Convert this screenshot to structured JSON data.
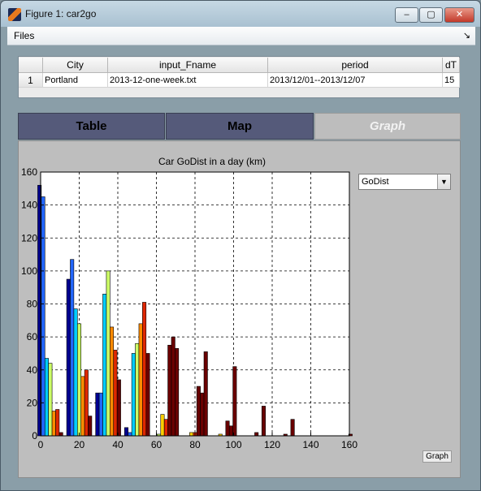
{
  "window": {
    "title": "Figure 1: car2go"
  },
  "menu": {
    "files": "Files",
    "dock_arrow": "↘"
  },
  "window_controls": {
    "minimize": "–",
    "maximize": "▢",
    "close": "✕"
  },
  "table": {
    "columns": [
      "",
      "City",
      "input_Fname",
      "period",
      "dT"
    ],
    "rows": [
      {
        "index": "1",
        "city": "Portland",
        "input_fname": "2013-12-one-week.txt",
        "period": "2013/12/01--2013/12/07",
        "dt": "15"
      }
    ]
  },
  "tabs": [
    {
      "label": "Table",
      "active": false
    },
    {
      "label": "Map",
      "active": false
    },
    {
      "label": "Graph",
      "active": true
    }
  ],
  "graph": {
    "selector_value": "GoDist",
    "button_label": "Graph"
  },
  "chart_data": {
    "type": "bar",
    "title": "Car GoDist in a day (km)",
    "xlim": [
      0,
      160
    ],
    "ylim": [
      0,
      160
    ],
    "xticks": [
      0,
      20,
      40,
      60,
      80,
      100,
      120,
      140,
      160
    ],
    "yticks": [
      0,
      20,
      40,
      60,
      80,
      100,
      120,
      140,
      160
    ],
    "grid": true,
    "bin_centers": [
      5,
      20,
      35,
      50,
      65,
      80,
      95,
      110,
      125,
      140,
      155
    ],
    "series_colors": [
      "#000090",
      "#0033cc",
      "#2266ff",
      "#00ccff",
      "#66ffcc",
      "#ccff66",
      "#ffd000",
      "#ff8c00",
      "#e02800",
      "#b00000",
      "#6a0000"
    ],
    "series": [
      {
        "values": [
          152,
          95,
          26,
          5,
          0,
          0,
          0,
          0,
          0,
          0,
          0
        ]
      },
      {
        "values": [
          145,
          107,
          26,
          2,
          1,
          0,
          0,
          0,
          0,
          0,
          0
        ]
      },
      {
        "values": [
          47,
          77,
          86,
          50,
          13,
          2,
          1,
          0,
          0,
          0,
          0
        ]
      },
      {
        "values": [
          44,
          68,
          100,
          56,
          10,
          2,
          0,
          0,
          0,
          0,
          0
        ]
      },
      {
        "values": [
          15,
          36,
          66,
          68,
          55,
          30,
          9,
          2,
          1,
          0,
          0
        ]
      },
      {
        "values": [
          16,
          40,
          52,
          81,
          60,
          26,
          6,
          0,
          0,
          0,
          0
        ]
      },
      {
        "values": [
          2,
          12,
          34,
          50,
          53,
          51,
          42,
          18,
          10,
          0,
          1
        ]
      }
    ]
  }
}
